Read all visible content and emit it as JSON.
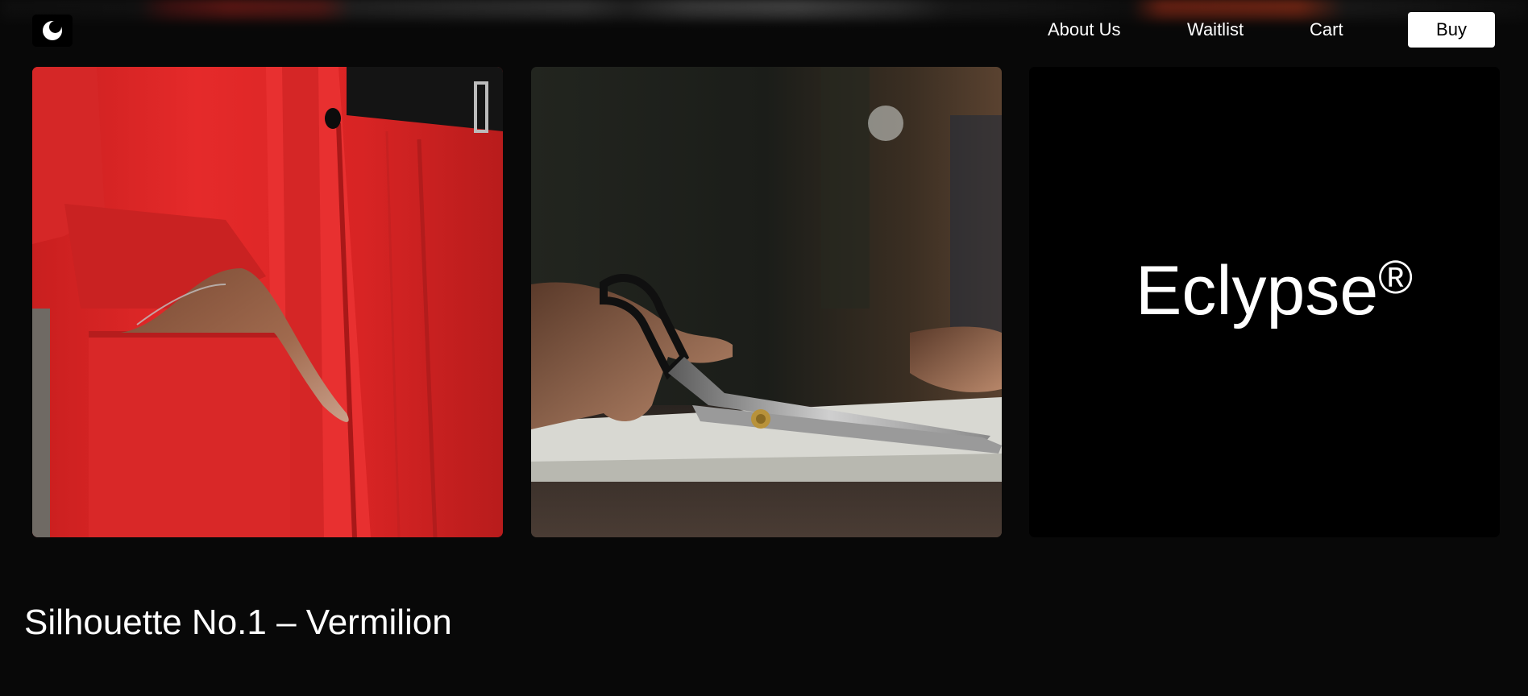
{
  "nav": {
    "logo_icon": "crescent-moon-logo-icon",
    "links": [
      {
        "label": "About Us"
      },
      {
        "label": "Waitlist"
      },
      {
        "label": "Cart"
      }
    ],
    "buy_label": "Buy"
  },
  "gallery": {
    "cards": [
      {
        "image": "red-suit-hand-in-pocket-photo"
      },
      {
        "image": "tailor-scissors-cutting-fabric-photo"
      },
      {
        "brand": "Eclypse",
        "brand_mark": "®"
      }
    ]
  },
  "product": {
    "title": "Silhouette No.1 – Vermilion"
  },
  "colors": {
    "background": "#080808",
    "accent_red": "#e32b2b",
    "button_bg": "#ffffff",
    "text": "#ffffff"
  }
}
